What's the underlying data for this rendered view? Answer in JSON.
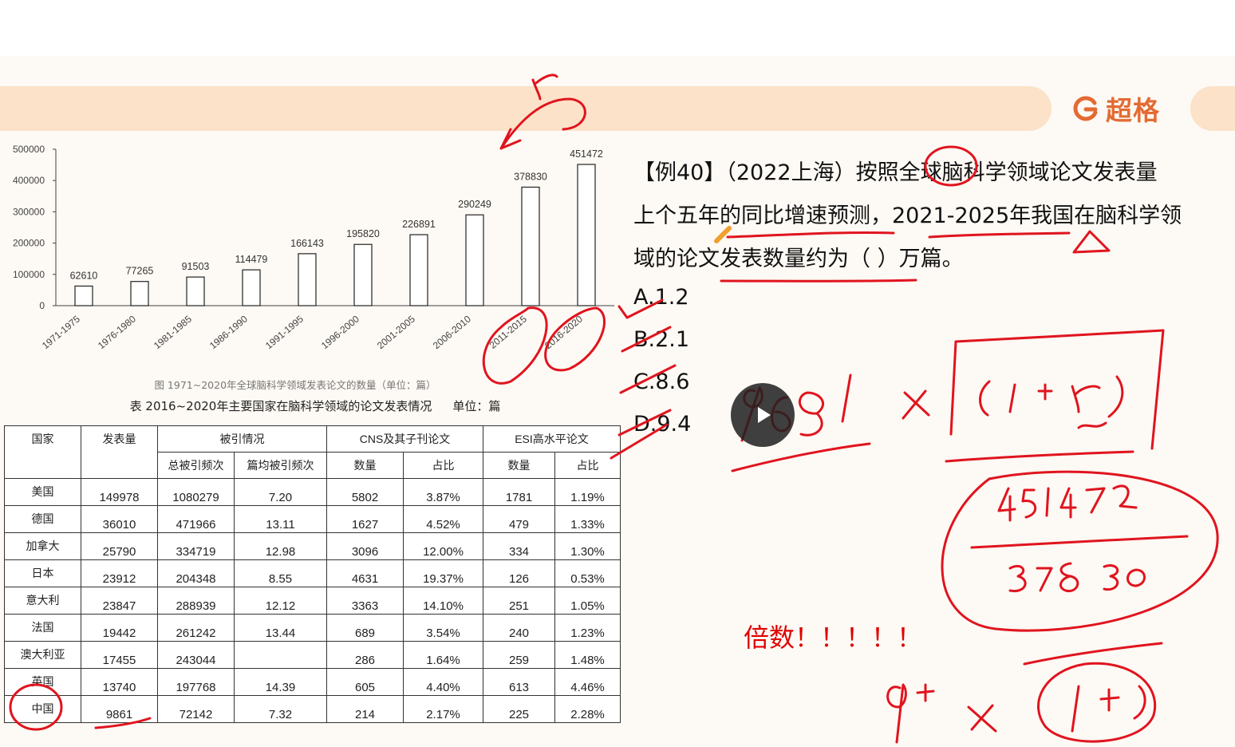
{
  "brand": {
    "logo_text": "超格"
  },
  "chart_data": {
    "type": "bar",
    "categories": [
      "1971-1975",
      "1976-1980",
      "1981-1985",
      "1986-1990",
      "1991-1995",
      "1996-2000",
      "2001-2005",
      "2006-2010",
      "2011-2015",
      "2016-2020"
    ],
    "values": [
      62610,
      77265,
      91503,
      114479,
      166143,
      195820,
      226891,
      290249,
      378830,
      451472
    ],
    "yticks": [
      0,
      100000,
      200000,
      300000,
      400000,
      500000
    ],
    "ylim": [
      0,
      500000
    ],
    "caption": "图 1971~2020年全球脑科学领域发表论文的数量（单位：篇）",
    "grid": false
  },
  "table": {
    "title": "表 2016~2020年主要国家在脑科学领域的论文发表情况",
    "unit": "单位：篇",
    "headers": {
      "country": "国家",
      "pubs": "发表量",
      "citations": "被引情况",
      "total_cites": "总被引频次",
      "avg_cites": "篇均被引频次",
      "cns": "CNS及其子刊论文",
      "cns_count": "数量",
      "cns_share": "占比",
      "esi": "ESI高水平论文",
      "esi_count": "数量",
      "esi_share": "占比"
    },
    "rows": [
      [
        "美国",
        "149978",
        "1080279",
        "7.20",
        "5802",
        "3.87%",
        "1781",
        "1.19%"
      ],
      [
        "德国",
        "36010",
        "471966",
        "13.11",
        "1627",
        "4.52%",
        "479",
        "1.33%"
      ],
      [
        "加拿大",
        "25790",
        "334719",
        "12.98",
        "3096",
        "12.00%",
        "334",
        "1.30%"
      ],
      [
        "日本",
        "23912",
        "204348",
        "8.55",
        "4631",
        "19.37%",
        "126",
        "0.53%"
      ],
      [
        "意大利",
        "23847",
        "288939",
        "12.12",
        "3363",
        "14.10%",
        "251",
        "1.05%"
      ],
      [
        "法国",
        "19442",
        "261242",
        "13.44",
        "689",
        "3.54%",
        "240",
        "1.23%"
      ],
      [
        "澳大利亚",
        "17455",
        "243044",
        "",
        "286",
        "1.64%",
        "259",
        "1.48%"
      ],
      [
        "英国",
        "13740",
        "197768",
        "14.39",
        "605",
        "4.40%",
        "613",
        "4.46%"
      ],
      [
        "中国",
        "9861",
        "72142",
        "7.32",
        "214",
        "2.17%",
        "225",
        "2.28%"
      ]
    ]
  },
  "question": {
    "line1": "【例40】（2022上海）按照全球脑科学领域论文发表量",
    "line2": "上个五年的同比增速预测，2021-2025年我国在脑科学领",
    "line3": "域的论文发表数量约为（  ）万篇。",
    "options": [
      "A.1.2",
      "B.2.1",
      "C.8.6",
      "D.9.4"
    ]
  },
  "annotations": {
    "note": "倍数！！！！！"
  },
  "colors": {
    "ink": "#e0141e",
    "brand": "#e36b33",
    "banner": "#fbe2c8"
  },
  "icons": [
    "logo-icon",
    "play-icon"
  ]
}
